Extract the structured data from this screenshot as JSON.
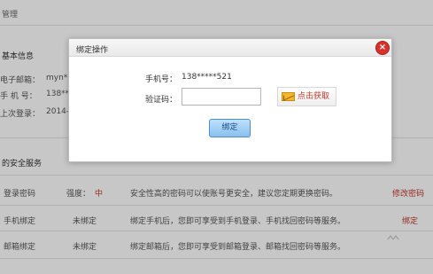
{
  "page": {
    "manage_title": "管理",
    "basic_info_title": "基本信息",
    "email_label": "电子邮箱：",
    "email_value": "myn*",
    "phone_label": "手 机 号：",
    "phone_value": "138**",
    "last_login_label": "上次登录：",
    "last_login_value": "2014-",
    "security_title": "的安全服务"
  },
  "security_rows": [
    {
      "name": "登录密码",
      "status": "强度：",
      "status_value": "中",
      "desc": "安全性高的密码可以使账号更安全，建议您定期更换密码。",
      "action": "修改密码"
    },
    {
      "name": "手机绑定",
      "status": "未绑定",
      "status_value": "",
      "desc": "绑定手机后，您即可享受到手机登录、手机找回密码等服务。",
      "action": "绑定"
    },
    {
      "name": "邮箱绑定",
      "status": "未绑定",
      "status_value": "",
      "desc": "绑定邮箱后，您即可享受到邮箱登录、邮箱找回密码等服务。",
      "action": ""
    }
  ],
  "modal": {
    "title": "绑定操作",
    "close_glyph": "×",
    "phone_label": "手机号：",
    "phone_value": "138*****521",
    "code_label": "验证码：",
    "code_value": "",
    "get_code_label": "点击获取",
    "bind_label": "绑定"
  },
  "colors": {
    "accent_red": "#c0392b",
    "button_blue": "#89c0ee"
  }
}
